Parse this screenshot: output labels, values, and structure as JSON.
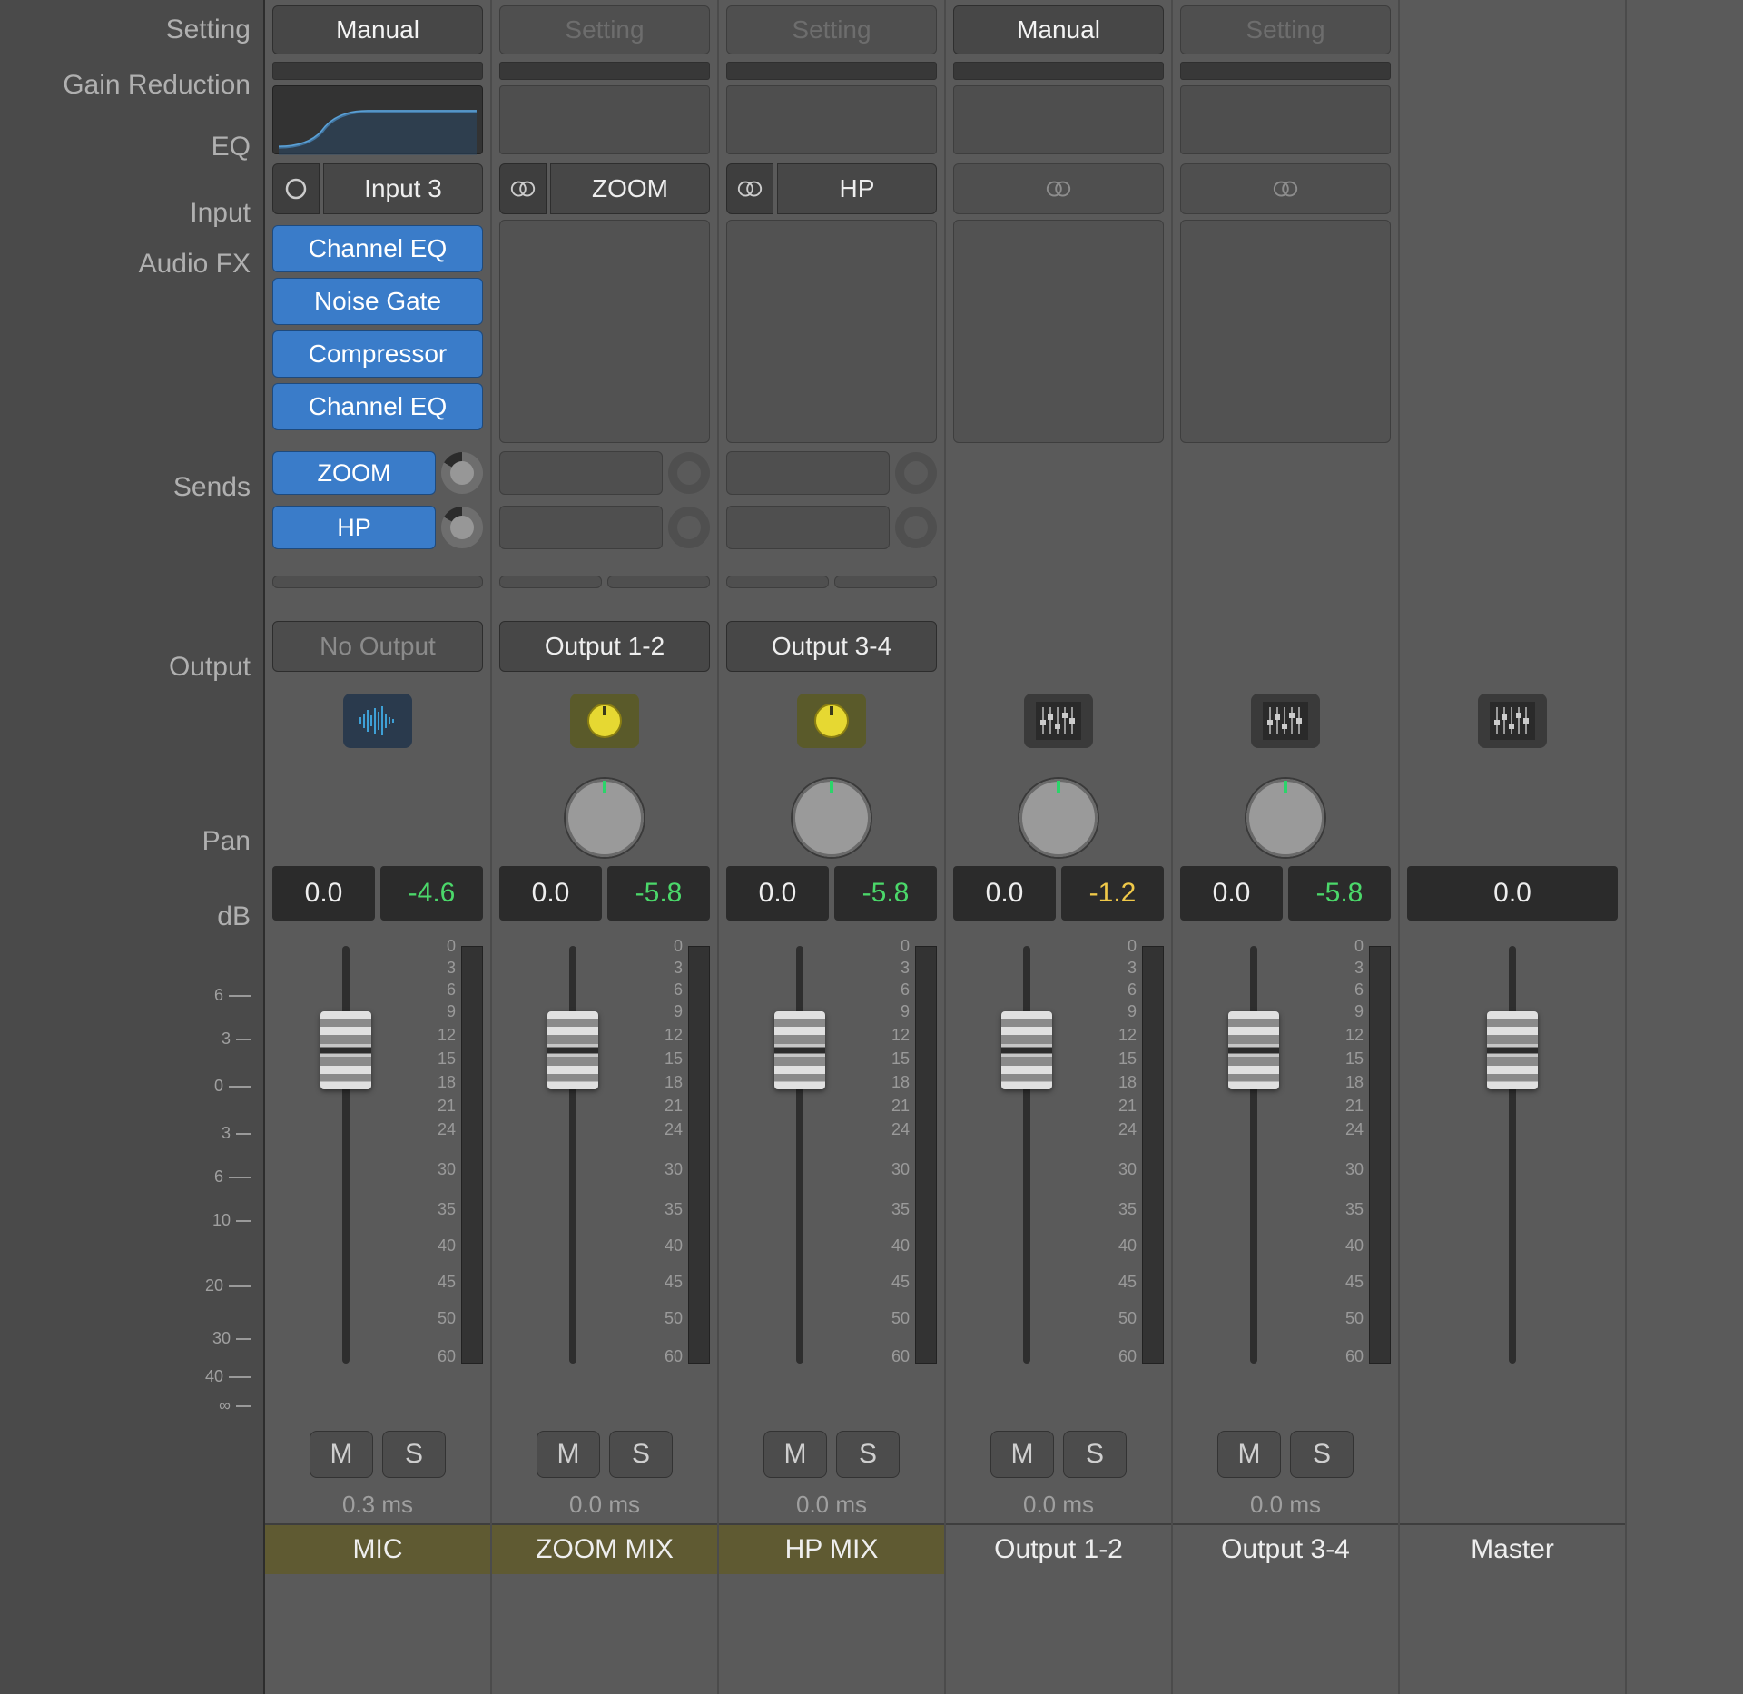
{
  "labels": {
    "setting": "Setting",
    "gain_reduction": "Gain Reduction",
    "eq": "EQ",
    "input": "Input",
    "audio_fx": "Audio FX",
    "sends": "Sends",
    "output": "Output",
    "pan": "Pan",
    "db": "dB"
  },
  "fader_scale": [
    "6",
    "3",
    "0",
    "3",
    "6",
    "10",
    "20",
    "30",
    "40",
    "∞"
  ],
  "meter_scale": [
    "0",
    "3",
    "6",
    "9",
    "12",
    "15",
    "18",
    "21",
    "24",
    "30",
    "35",
    "40",
    "45",
    "50",
    "60"
  ],
  "buttons": {
    "mute": "M",
    "solo": "S"
  },
  "channels": [
    {
      "name": "MIC",
      "strip_color": "olive",
      "setting": "Manual",
      "setting_style": "primary",
      "has_gain": true,
      "has_eq_curve": true,
      "input_mode": "mono",
      "input_name": "Input 3",
      "fx": [
        "Channel EQ",
        "Noise Gate",
        "Compressor",
        "Channel EQ"
      ],
      "sends": [
        "ZOOM",
        "HP"
      ],
      "output": "No Output",
      "output_dim": true,
      "icon": "wave",
      "has_pan": false,
      "db_val": "0.0",
      "db_peak": "-4.6",
      "db_peak_class": "green",
      "latency": "0.3 ms"
    },
    {
      "name": "ZOOM MIX",
      "strip_color": "olive",
      "setting": "Setting",
      "setting_style": "dim",
      "has_gain": true,
      "has_eq_curve": false,
      "input_mode": "stereo",
      "input_name": "ZOOM",
      "fx": [],
      "sends": [],
      "sends_dim_rows": 3,
      "output": "Output 1-2",
      "icon": "aux",
      "has_pan": true,
      "db_val": "0.0",
      "db_peak": "-5.8",
      "db_peak_class": "green",
      "latency": "0.0 ms"
    },
    {
      "name": "HP MIX",
      "strip_color": "olive",
      "setting": "Setting",
      "setting_style": "dim",
      "has_gain": true,
      "has_eq_curve": false,
      "input_mode": "stereo",
      "input_name": "HP",
      "fx": [],
      "sends": [],
      "sends_dim_rows": 3,
      "output": "Output 3-4",
      "icon": "aux",
      "has_pan": true,
      "db_val": "0.0",
      "db_peak": "-5.8",
      "db_peak_class": "green",
      "latency": "0.0 ms"
    },
    {
      "name": "Output 1-2",
      "strip_color": "grey",
      "setting": "Manual",
      "setting_style": "primary",
      "has_gain": true,
      "has_eq_curve": false,
      "input_mode": "stereo",
      "input_name": "",
      "input_full": true,
      "fx": [],
      "sends": [],
      "output": "",
      "icon": "mix",
      "has_pan": true,
      "db_val": "0.0",
      "db_peak": "-1.2",
      "db_peak_class": "yellow",
      "latency": "0.0 ms"
    },
    {
      "name": "Output 3-4",
      "strip_color": "grey",
      "setting": "Setting",
      "setting_style": "dim",
      "has_gain": true,
      "has_eq_curve": false,
      "input_mode": "stereo",
      "input_name": "",
      "input_full": true,
      "fx": [],
      "sends": [],
      "output": "",
      "icon": "mix",
      "has_pan": true,
      "db_val": "0.0",
      "db_peak": "-5.8",
      "db_peak_class": "green",
      "latency": "0.0 ms"
    },
    {
      "name": "Master",
      "strip_color": "grey",
      "setting": "",
      "has_gain": false,
      "has_eq_curve": false,
      "icon": "mix",
      "has_pan": false,
      "db_val": "0.0",
      "db_peak": "",
      "no_ms": true,
      "no_meter": true
    }
  ]
}
